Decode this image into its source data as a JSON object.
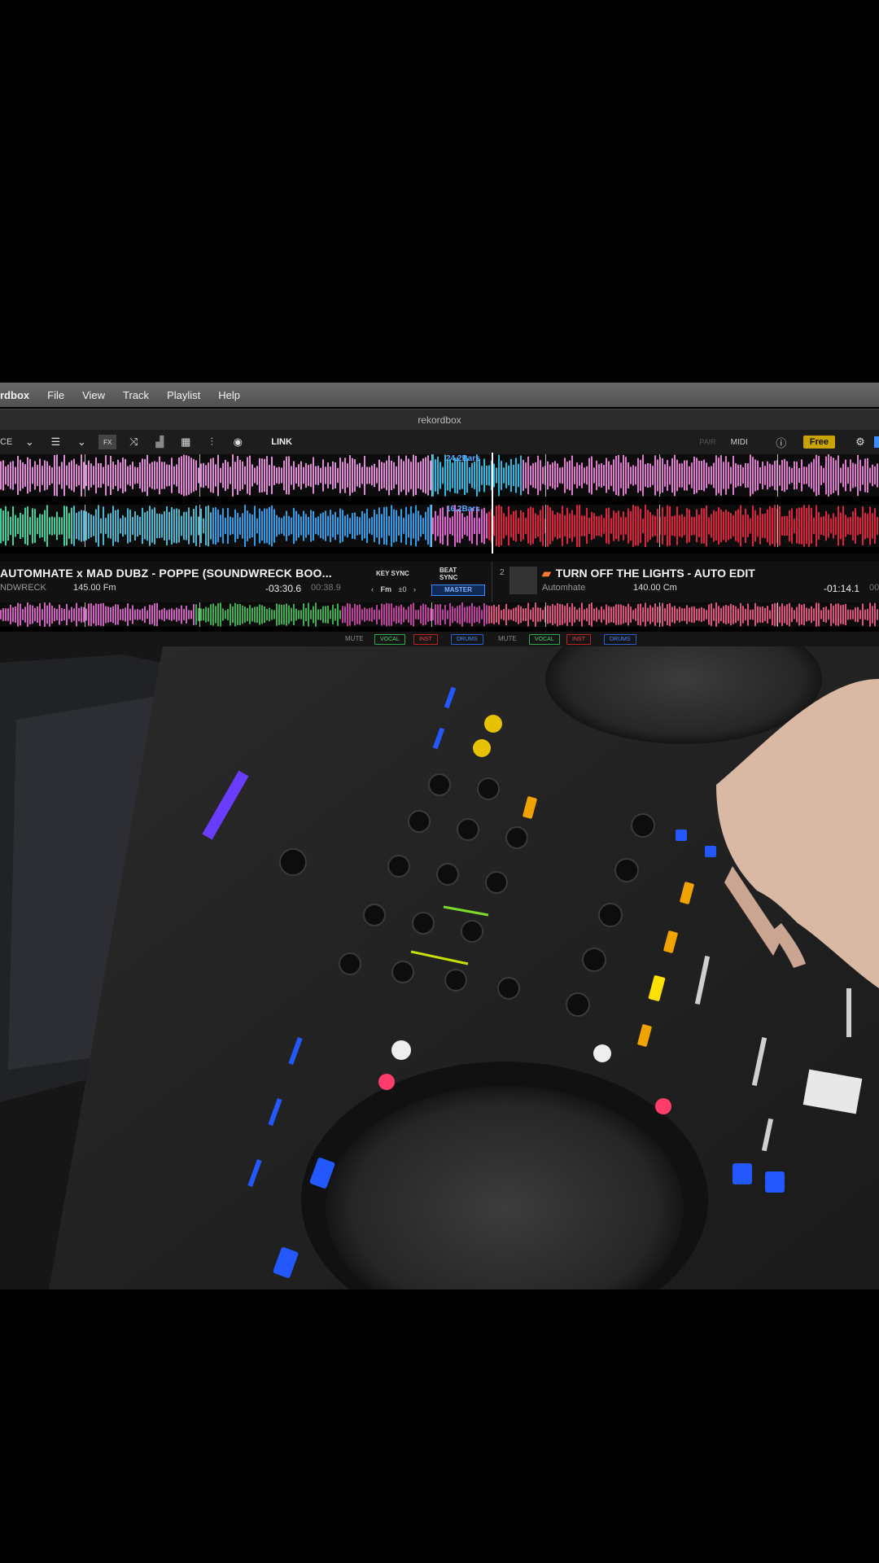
{
  "menubar": {
    "app_name": "rdbox",
    "items": [
      "File",
      "View",
      "Track",
      "Playlist",
      "Help"
    ]
  },
  "window": {
    "title": "rekordbox"
  },
  "toolbar": {
    "left_label": "CE",
    "link_label": "LINK",
    "pair_label": "PAIR",
    "midi_label": "MIDI",
    "plan_label": "Free"
  },
  "waveform": {
    "deck_a_bars": "24.2Bars",
    "deck_b_bars": "16.2Bars"
  },
  "deck_a": {
    "title": "AUTOMHATE x MAD DUBZ - POPPE (SOUNDWRECK BOO...",
    "artist": "NDWRECK",
    "bpm_key": "145.00 Fm",
    "remaining": "-03:30.6",
    "elapsed": "00:38.9",
    "key_sync_label": "KEY SYNC",
    "key_value": "Fm",
    "key_offset": "±0",
    "beat_sync_label": "BEAT SYNC",
    "master_label": "MASTER"
  },
  "deck_b": {
    "number": "2",
    "title": "TURN OFF THE LIGHTS - AUTO EDIT",
    "artist": "Automhate",
    "bpm_key": "140.00 Cm",
    "remaining": "-01:14.1",
    "elapsed": "00"
  },
  "stems": {
    "mute_label": "MUTE",
    "vocal": "VOCAL",
    "inst": "INST",
    "drums": "DRUMS"
  },
  "colors": {
    "menubar": "#5a5a5a",
    "free_badge": "#c9a400",
    "master_blue": "#3b8cff",
    "beat_label": "#5aa8ff"
  }
}
